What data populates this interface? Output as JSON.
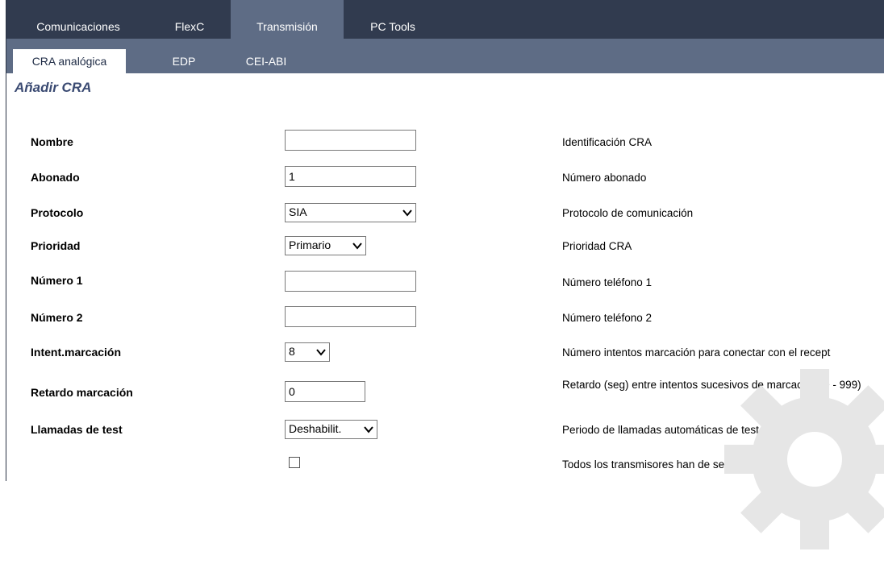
{
  "top_tabs": [
    "Comunicaciones",
    "FlexC",
    "Transmisión",
    "PC Tools"
  ],
  "sub_tabs": [
    "CRA analógica",
    "EDP",
    "CEI-ABI"
  ],
  "page_title": "Añadir CRA",
  "form": {
    "nombre": {
      "label": "Nombre",
      "value": "",
      "desc": "Identificación CRA"
    },
    "abonado": {
      "label": "Abonado",
      "value": "1",
      "desc": "Número abonado"
    },
    "protocolo": {
      "label": "Protocolo",
      "value": "SIA",
      "desc": "Protocolo de comunicación"
    },
    "prioridad": {
      "label": "Prioridad",
      "value": "Primario",
      "desc": "Prioridad CRA"
    },
    "numero1": {
      "label": "Número 1",
      "value": "",
      "desc": "Número teléfono 1"
    },
    "numero2": {
      "label": "Número 2",
      "value": "",
      "desc": "Número teléfono 2"
    },
    "intent": {
      "label": "Intent.marcación",
      "value": "8",
      "desc": "Número intentos marcación para conectar con el recept"
    },
    "retardo": {
      "label": "Retardo marcación",
      "value": "0",
      "desc": "Retardo (seg) entre intentos sucesivos de marcación (0 - 999)"
    },
    "test": {
      "label": "Llamadas de test",
      "value": "Deshabilit.",
      "desc": "Periodo de llamadas automáticas de test"
    },
    "verificados": {
      "checked": false,
      "desc": "Todos los transmisores han de ser verificados"
    }
  },
  "colors": {
    "nav_dark": "#313b4f",
    "nav_mid": "#5e6c85",
    "title": "#3a4a72"
  }
}
